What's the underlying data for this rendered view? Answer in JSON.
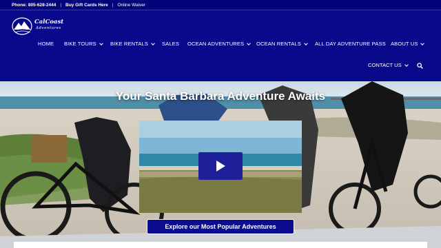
{
  "topbar": {
    "phone": "Phone: 805-628-2444",
    "separator": "|",
    "gift_cards": "Buy Gift Cards Here",
    "waiver": "Online Waiver"
  },
  "brand": {
    "logo_line1": "CalCoast",
    "logo_line2": "Adventures"
  },
  "nav": {
    "items": [
      {
        "label": "HOME"
      },
      {
        "label": "BIKE TOURS"
      },
      {
        "label": "BIKE RENTALS"
      },
      {
        "label": "SALES"
      },
      {
        "label": "OCEAN ADVENTURES"
      },
      {
        "label": "OCEAN RENTALS"
      },
      {
        "label": "ALL DAY ADVENTURE PASS"
      },
      {
        "label": "ABOUT US"
      },
      {
        "label": "CONTACT US"
      }
    ]
  },
  "hero": {
    "title": "Your Santa Barbara Adventure Awaits",
    "cta_label": "Explore our Most Popular Adventures"
  },
  "colors": {
    "brand_navy": "#08088a",
    "topbar": "#04047a",
    "play_button": "#1f1f9a"
  },
  "icons": [
    "logo-mountain-icon",
    "chevron-down-icon",
    "search-icon",
    "play-icon"
  ]
}
